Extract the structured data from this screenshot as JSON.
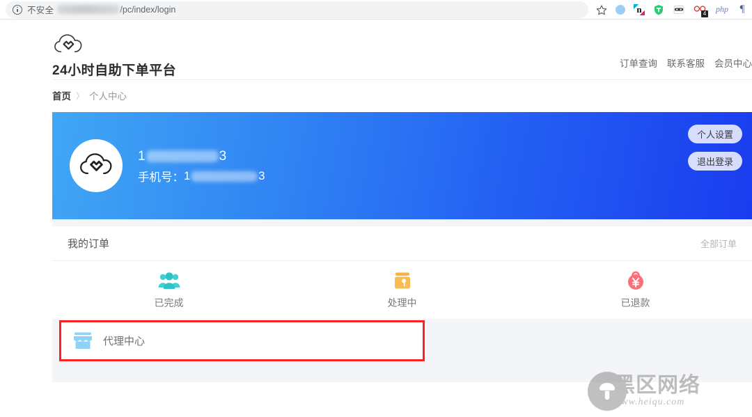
{
  "browser": {
    "security_label": "不安全",
    "url_suffix": "/pc/index/login",
    "security_icon": "info-circle-icon",
    "bookmark_icon": "star-icon",
    "extensions": [
      {
        "name": "blue-dot-extension-icon",
        "label": ""
      },
      {
        "name": "n-extension-icon",
        "label": "n"
      },
      {
        "name": "green-shield-extension-icon",
        "label": "T"
      },
      {
        "name": "masked-face-extension-icon",
        "label": ""
      },
      {
        "name": "red-glasses-extension-icon",
        "label": "",
        "badge": "4"
      },
      {
        "name": "php-extension-icon",
        "label": "php"
      },
      {
        "name": "pilcrow-extension-icon",
        "label": "¶"
      }
    ]
  },
  "site": {
    "logo_icon": "cloud-logo-icon",
    "title": "24小时自助下单平台",
    "nav": [
      {
        "label": "订单查询",
        "name": "nav-order-query"
      },
      {
        "label": "联系客服",
        "name": "nav-contact-support"
      },
      {
        "label": "会员中心",
        "name": "nav-member-center"
      }
    ]
  },
  "breadcrumb": {
    "home": "首页",
    "separator": "〉",
    "current": "个人中心"
  },
  "profile": {
    "avatar_icon": "cloud-avatar-icon",
    "username_prefix": "1",
    "username_suffix": "3",
    "phone_label": "手机号：",
    "phone_prefix": "1",
    "phone_suffix": "3",
    "settings_button": "个人设置",
    "logout_button": "退出登录",
    "gradient_from": "#41a7f5",
    "gradient_to": "#1a3cef"
  },
  "orders": {
    "title": "我的订单",
    "more_label": "全部订单",
    "statuses": [
      {
        "label": "已完成",
        "icon": "people-icon",
        "color": "#3fd0d4",
        "name": "order-status-completed"
      },
      {
        "label": "处理中",
        "icon": "wallet-key-icon",
        "color": "#f7b23f",
        "name": "order-status-processing"
      },
      {
        "label": "已退款",
        "icon": "refund-yuan-icon",
        "color": "#f9707a",
        "name": "order-status-refunded"
      }
    ]
  },
  "agent": {
    "label": "代理中心",
    "icon": "storefront-icon",
    "icon_color": "#8ed3f7",
    "highlight_color": "#fb2222"
  },
  "watermark": {
    "logo_icon": "mushroom-logo-icon",
    "brand": "黑区网络",
    "url": "www.heiqu.com"
  }
}
